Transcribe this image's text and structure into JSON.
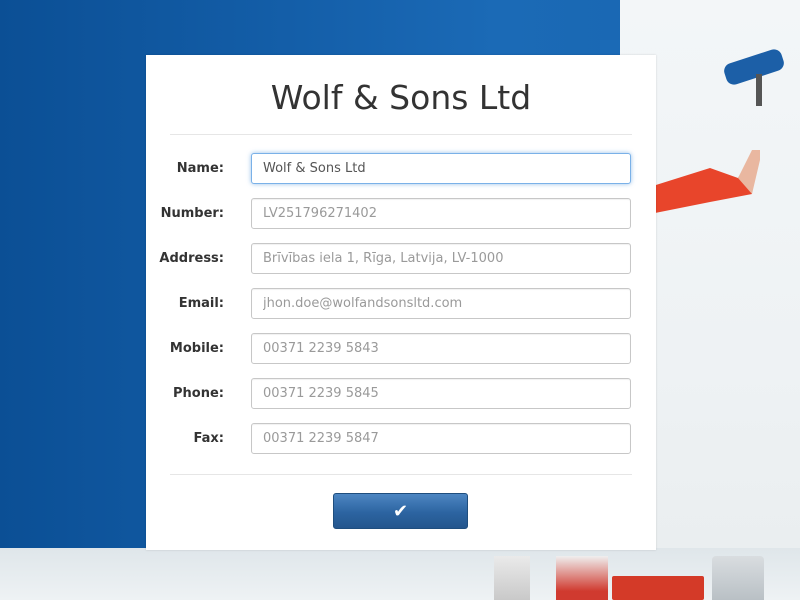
{
  "company": {
    "title": "Wolf & Sons Ltd"
  },
  "form": {
    "fields": [
      {
        "label": "Name:",
        "value": "Wolf & Sons Ltd",
        "placeholder": ""
      },
      {
        "label": "Number:",
        "value": "",
        "placeholder": "LV251796271402"
      },
      {
        "label": "Address:",
        "value": "",
        "placeholder": "Brīvības iela 1, Rīga, Latvija, LV-1000"
      },
      {
        "label": "Email:",
        "value": "",
        "placeholder": "jhon.doe@wolfandsonsltd.com"
      },
      {
        "label": "Mobile:",
        "value": "",
        "placeholder": "00371 2239 5843"
      },
      {
        "label": "Phone:",
        "value": "",
        "placeholder": "00371 2239 5845"
      },
      {
        "label": "Fax:",
        "value": "",
        "placeholder": "00371 2239 5847"
      }
    ],
    "submit": {
      "icon": "checkmark-icon",
      "glyph": "✔"
    }
  },
  "colors": {
    "accent": "#2c64a1",
    "focus_border": "#7ab1e8",
    "background_blue": "#1662ad"
  }
}
